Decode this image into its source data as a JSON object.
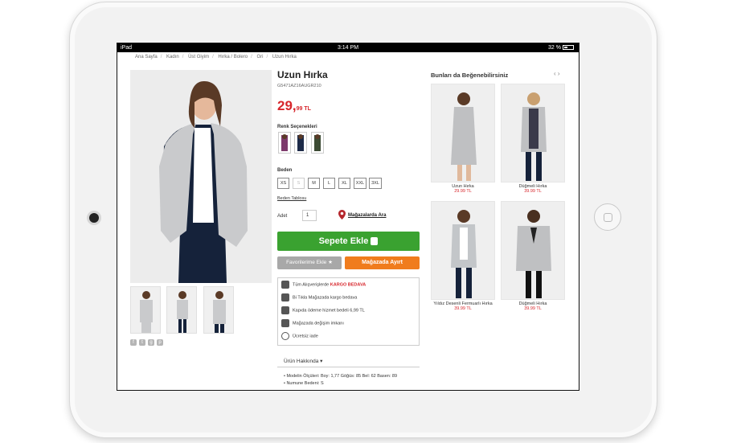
{
  "status": {
    "device": "iPad",
    "time": "3:14 PM",
    "battery": "32 %"
  },
  "breadcrumb": [
    "Ana Sayfa",
    "Kadın",
    "Üst Giyim",
    "Hırka / Bolero",
    "Gri",
    "Uzun Hırka"
  ],
  "product": {
    "title": "Uzun Hırka",
    "sku": "G5471AZ16AUGR210",
    "price_main": "29,",
    "price_sub": "99 TL",
    "colors_label": "Renk Seçenekleri",
    "size_label": "Beden",
    "sizes": [
      "XS",
      "S",
      "M",
      "L",
      "XL",
      "XXL",
      "3XL"
    ],
    "size_chart": "Beden Tablosu",
    "qty_label": "Adet",
    "qty_value": "1",
    "store_search": "Mağazalarda Ara",
    "add_to_cart": "Sepete Ekle",
    "add_favorites": "Favorilerime Ekle ★",
    "reserve_store": "Mağazada Ayırt",
    "info": {
      "row1_prefix": "Tüm Alışverişlerde",
      "row1_highlight": "KARGO BEDAVA",
      "row2": "Bi Tıkla Mağazada kargo bedava",
      "row3": "Kapıda ödeme hizmet bedeli 6,99 TL",
      "row4": "Mağazada değişim imkanı",
      "row5": "Ücretsiz iade"
    },
    "about": "Ürün Hakkında ▾",
    "details": [
      "• Modelin Ölçüleri: Boy: 1,77 Göğüs: 85 Bel: 62 Basen: 89",
      "• Numune Bedeni: S"
    ]
  },
  "recommendations": {
    "title": "Bunları da Beğenebilirsiniz",
    "nav": "‹  ›",
    "items": [
      {
        "name": "Uzun Hırka",
        "price": "29.99 TL"
      },
      {
        "name": "Düğmeli Hırka",
        "price": "39.99 TL"
      },
      {
        "name": "Yıldız Desenli Fermuarlı Hırka",
        "price": "39.99 TL"
      },
      {
        "name": "Düğmeli Hırka",
        "price": "39.99 TL"
      }
    ]
  },
  "colors": {
    "accent_red": "#d7262c",
    "cart_green": "#3aa230",
    "store_orange": "#f07c1d"
  }
}
